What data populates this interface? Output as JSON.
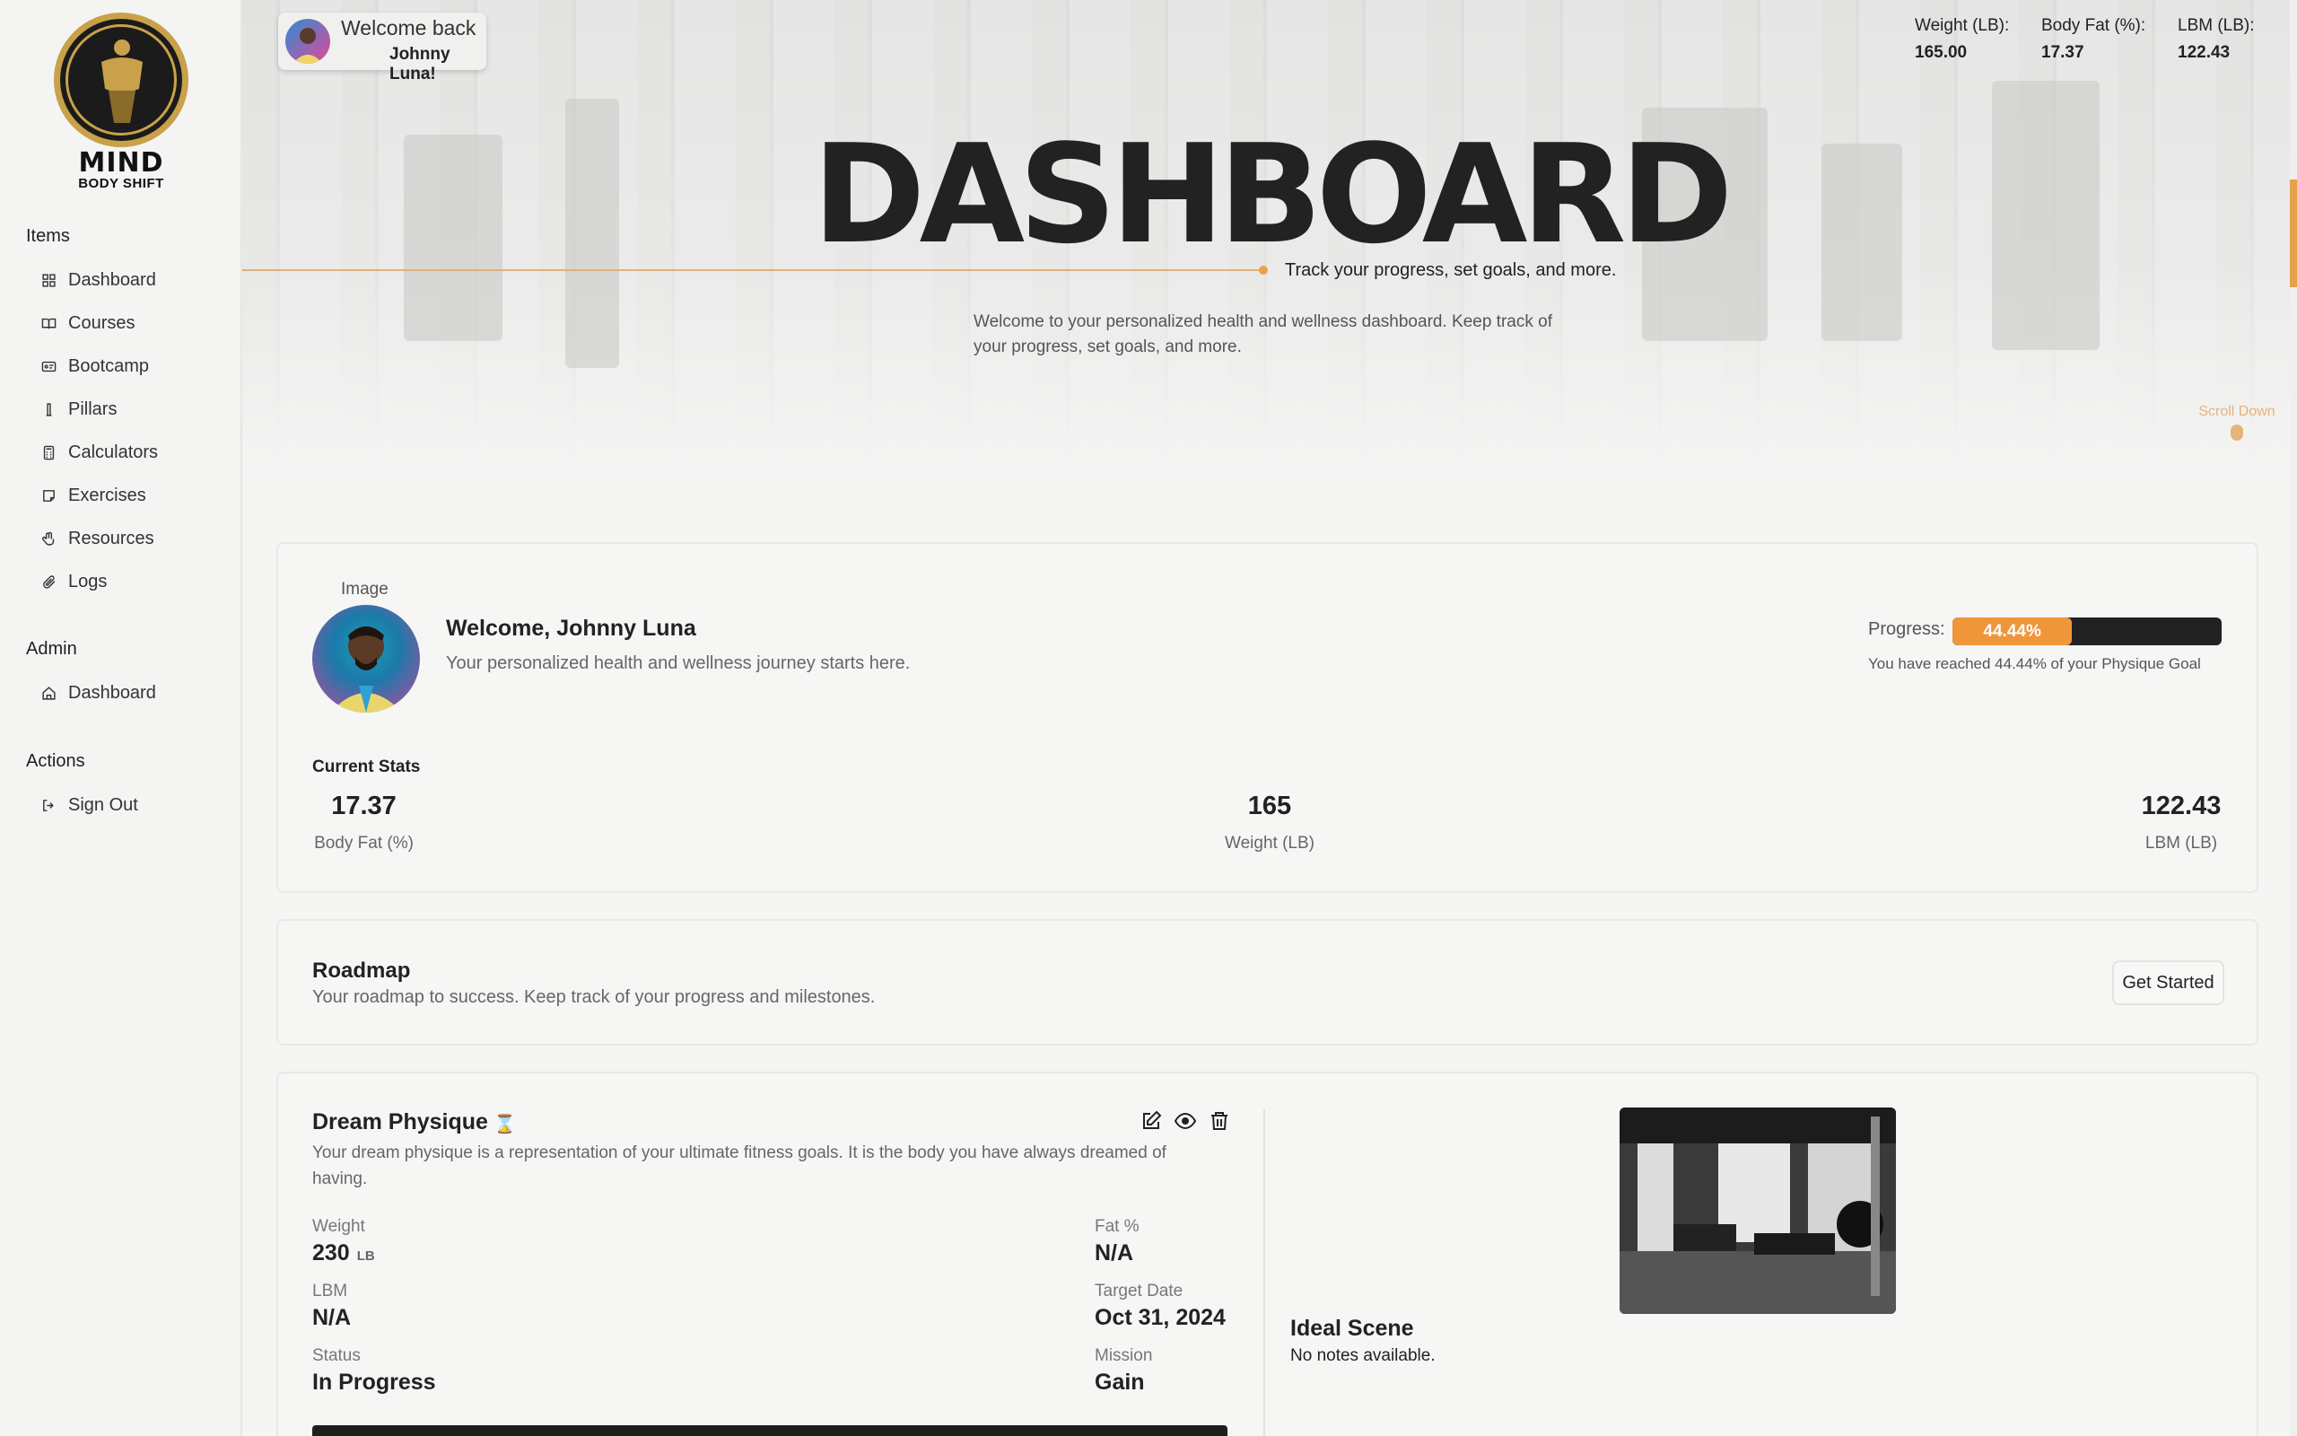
{
  "brand": {
    "name": "MIND",
    "subtitle": "BODY SHIFT"
  },
  "sidebar": {
    "groups": [
      {
        "title": "Items",
        "items": [
          {
            "label": "Dashboard",
            "icon": "grid-icon"
          },
          {
            "label": "Courses",
            "icon": "book-icon"
          },
          {
            "label": "Bootcamp",
            "icon": "id-card-icon"
          },
          {
            "label": "Pillars",
            "icon": "pillar-icon"
          },
          {
            "label": "Calculators",
            "icon": "calculator-icon"
          },
          {
            "label": "Exercises",
            "icon": "note-icon"
          },
          {
            "label": "Resources",
            "icon": "hand-icon"
          },
          {
            "label": "Logs",
            "icon": "paperclip-icon"
          }
        ]
      },
      {
        "title": "Admin",
        "items": [
          {
            "label": "Dashboard",
            "icon": "home-icon"
          }
        ]
      },
      {
        "title": "Actions",
        "items": [
          {
            "label": "Sign Out",
            "icon": "sign-out-icon"
          }
        ]
      }
    ]
  },
  "header": {
    "welcome_line1": "Welcome back",
    "welcome_line2": "Johnny Luna!",
    "stats": [
      {
        "label": "Weight (LB):",
        "value": "165.00"
      },
      {
        "label": "Body Fat (%):",
        "value": "17.37"
      },
      {
        "label": "LBM (LB):",
        "value": "122.43"
      }
    ]
  },
  "hero": {
    "title": "DASHBOARD",
    "tagline": "Track your progress, set goals, and more.",
    "description": "Welcome to your personalized health and wellness dashboard. Keep track of your progress, set goals, and more.",
    "scroll_label": "Scroll Down"
  },
  "profile": {
    "image_label": "Image",
    "welcome": "Welcome, Johnny Luna",
    "subtitle": "Your personalized health and wellness journey starts here.",
    "progress_label": "Progress:",
    "progress_value": 44.44,
    "progress_text": "44.44%",
    "progress_note": "You have reached 44.44% of your Physique Goal",
    "stats_title": "Current Stats",
    "stats": [
      {
        "value": "17.37",
        "caption": "Body Fat (%)"
      },
      {
        "value": "165",
        "caption": "Weight (LB)"
      },
      {
        "value": "122.43",
        "caption": "LBM (LB)"
      }
    ]
  },
  "roadmap": {
    "title": "Roadmap",
    "subtitle": "Your roadmap to success. Keep track of your progress and milestones.",
    "button": "Get Started"
  },
  "dream": {
    "title": "Dream Physique",
    "status_icon": "hourglass-icon",
    "description": "Your dream physique is a representation of your ultimate fitness goals. It is the body you have always dreamed of having.",
    "fields": {
      "weight_label": "Weight",
      "weight_value": "230",
      "weight_unit": "LB",
      "fat_label": "Fat %",
      "fat_value": "N/A",
      "lbm_label": "LBM",
      "lbm_value": "N/A",
      "target_label": "Target Date",
      "target_value": "Oct 31, 2024",
      "status_label": "Status",
      "status_value": "In Progress",
      "mission_label": "Mission",
      "mission_value": "Gain"
    },
    "ideal_title": "Ideal Scene",
    "ideal_note": "No notes available."
  },
  "colors": {
    "accent": "#f0963a",
    "dark": "#222222",
    "gold": "#c9a14a"
  }
}
